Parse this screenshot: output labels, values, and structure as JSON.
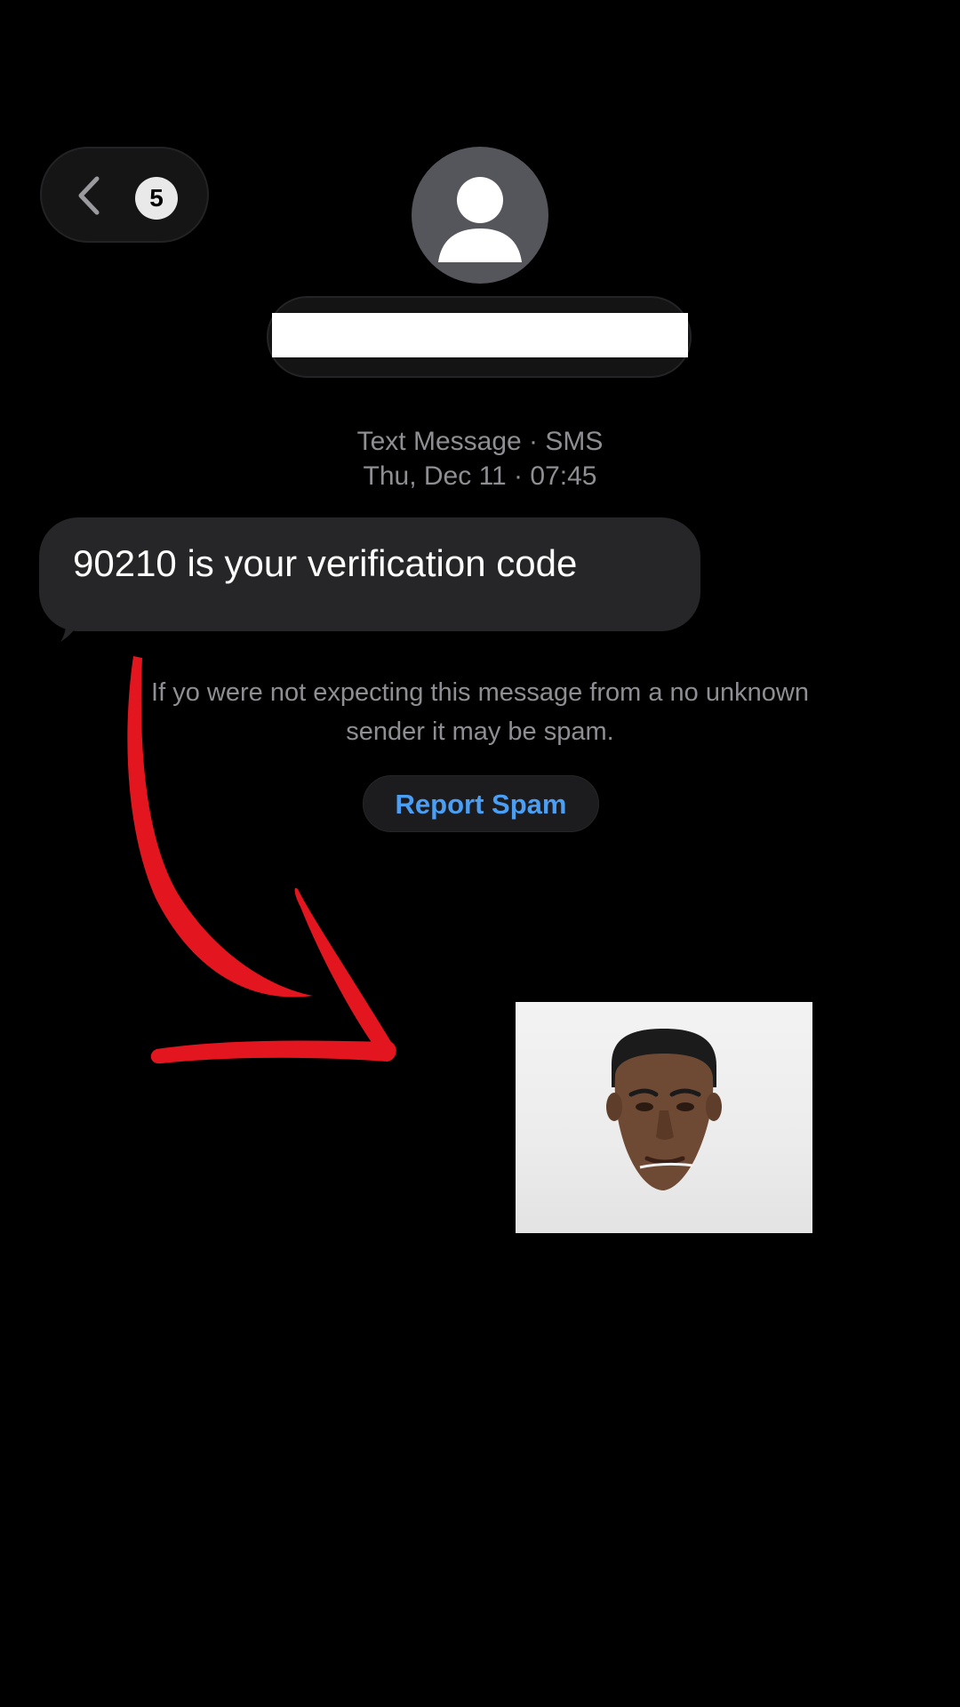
{
  "header": {
    "back_icon": "chevron-left-icon",
    "unread_count": "5",
    "contact_avatar_icon": "person-silhouette-icon",
    "contact_name_redacted": true
  },
  "conversation": {
    "channel_label": "Text Message · SMS",
    "timestamp": "Thu, Dec 11 · 07:45",
    "messages": [
      {
        "text": "90210 is your verification code",
        "direction": "incoming"
      }
    ]
  },
  "spam_notice": {
    "line_1": "If yo  were not expecting this message from a no unknown",
    "line_2": "sender it may be spam.",
    "report_button_label": "Report Spam"
  },
  "overlay": {
    "arrow_color": "#e3161f",
    "image_icon": "face-photo"
  },
  "colors": {
    "background": "#000000",
    "bubble": "#262628",
    "secondary_text": "#8e8e93",
    "link": "#4a9ff5"
  }
}
